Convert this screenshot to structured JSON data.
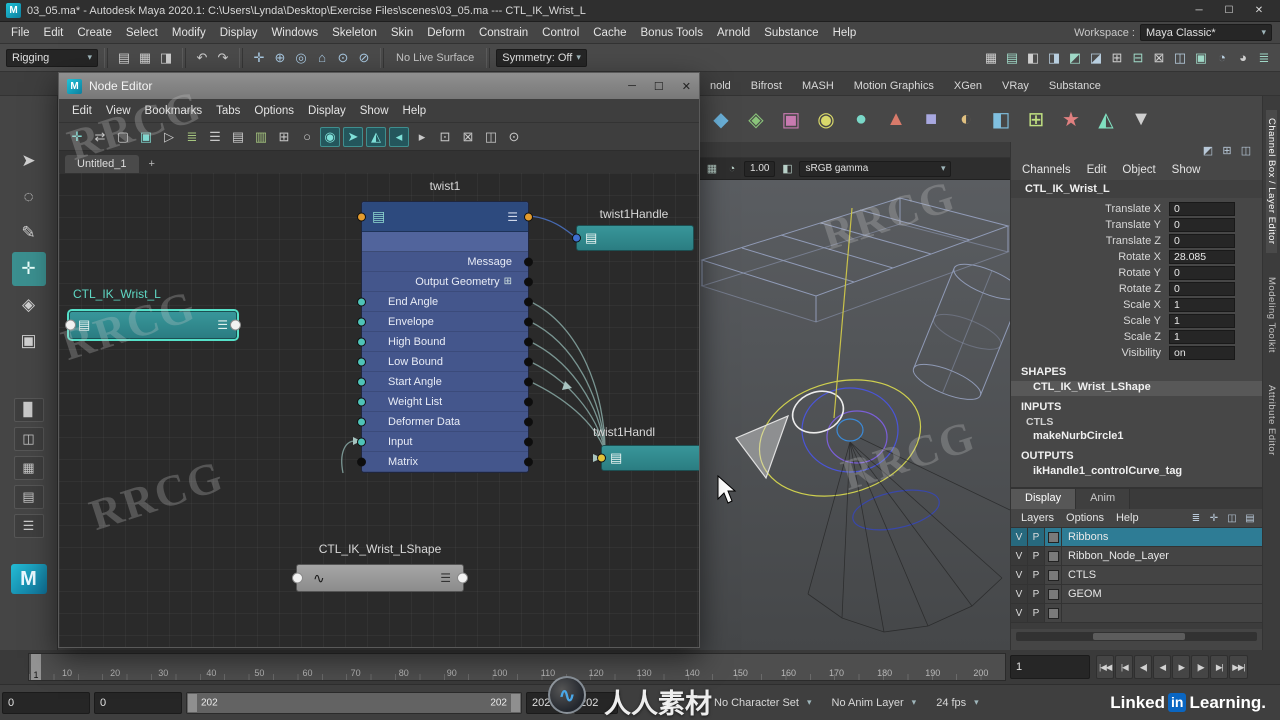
{
  "ui": {
    "caret": "▾"
  },
  "branding": {
    "badge": "M",
    "linkedin": "Linked",
    "in": "in",
    "learning": "Learning."
  },
  "window": {
    "title": "03_05.ma* - Autodesk Maya 2020.1: C:\\Users\\Lynda\\Desktop\\Exercise Files\\scenes\\03_05.ma --- CTL_IK_Wrist_L",
    "minimize": "─",
    "maximize": "☐",
    "close": "✕"
  },
  "menu_bar": {
    "items": [
      "File",
      "Edit",
      "Create",
      "Select",
      "Modify",
      "Display",
      "Windows",
      "Skeleton",
      "Skin",
      "Deform",
      "Constrain",
      "Control",
      "Cache",
      "Bonus Tools",
      "Arnold",
      "Substance",
      "Help"
    ],
    "workspace_label": "Workspace :",
    "workspace_value": "Maya Classic*"
  },
  "status_line": {
    "mode": "Rigging",
    "file_icons": [
      "▤",
      "▦",
      "◨"
    ],
    "snap_icons": [
      "✛",
      "⊕",
      "◎",
      "⌂",
      "⊙",
      "⊘"
    ],
    "hist_icons": [
      "↶",
      "↷"
    ],
    "live_surface": "No Live Surface",
    "symmetry": "Symmetry: Off",
    "right_icons": [
      "▦",
      "▤",
      "◧",
      "◨",
      "◩",
      "◪",
      "⊞",
      "⊟",
      "⊠",
      "◫",
      "▣",
      "◔",
      "◕",
      "≣"
    ]
  },
  "shelf": {
    "tabs": [
      "nold",
      "Bifrost",
      "MASH",
      "Motion Graphics",
      "XGen",
      "VRay",
      "Substance"
    ],
    "icons": [
      "◆",
      "◈",
      "▣",
      "◉",
      "●",
      "▲",
      "■",
      "◐",
      "◧",
      "⊞",
      "★",
      "◭",
      "▼"
    ]
  },
  "toolbox": {
    "tools": [
      "➤",
      "◌",
      "✎",
      "✛",
      "◈",
      "▣"
    ],
    "layouts": [
      "▉",
      "◫",
      "▦",
      "▤",
      "☰"
    ],
    "logo": "M"
  },
  "node_editor": {
    "title": "Node Editor",
    "menus": [
      "Edit",
      "View",
      "Bookmarks",
      "Tabs",
      "Options",
      "Display",
      "Show",
      "Help"
    ],
    "toolbar_icons": [
      "✛",
      "⇄",
      "▢",
      "▣",
      "▷",
      "≣",
      "☰",
      "▤",
      "▥",
      "⊞",
      "○",
      "◉",
      "➤",
      "◭",
      "◂",
      "▸",
      "⊡",
      "⊠",
      "◫",
      "⊙"
    ],
    "tab": "Untitled_1",
    "tab_add": "+",
    "glyphs": {
      "stack": "▤",
      "menu": "☰",
      "file": "▤",
      "curve": "∿",
      "expand": "⊞"
    },
    "twist1": {
      "title": "twist1",
      "rows": [
        "Message",
        "Output Geometry",
        "End Angle",
        "Envelope",
        "High Bound",
        "Low Bound",
        "Start Angle",
        "Weight List",
        "Deformer Data",
        "Input",
        "Matrix"
      ]
    },
    "handle1": {
      "title": "twist1Handle"
    },
    "wrist": {
      "title": "CTL_IK_Wrist_L"
    },
    "handle2": {
      "title": "twist1Handl"
    },
    "shape": {
      "title": "CTL_IK_Wrist_LShape"
    }
  },
  "viewport": {
    "exposure": "1.00",
    "gamma": "sRGB gamma",
    "icons": [
      "▦",
      "◔",
      "◧"
    ]
  },
  "channel_box": {
    "mini_icons": [
      "◩",
      "⊞",
      "◫"
    ],
    "menus": [
      "Channels",
      "Edit",
      "Object",
      "Show"
    ],
    "object_name": "CTL_IK_Wrist_L",
    "attributes": [
      {
        "label": "Translate X",
        "value": "0"
      },
      {
        "label": "Translate Y",
        "value": "0"
      },
      {
        "label": "Translate Z",
        "value": "0"
      },
      {
        "label": "Rotate X",
        "value": "28.085"
      },
      {
        "label": "Rotate Y",
        "value": "0"
      },
      {
        "label": "Rotate Z",
        "value": "0"
      },
      {
        "label": "Scale X",
        "value": "1"
      },
      {
        "label": "Scale Y",
        "value": "1"
      },
      {
        "label": "Scale Z",
        "value": "1"
      },
      {
        "label": "Visibility",
        "value": "on"
      }
    ],
    "shapes_header": "SHAPES",
    "shape_name": "CTL_IK_Wrist_LShape",
    "inputs_header": "INPUTS",
    "inputs": [
      "CTLS",
      "makeNurbCircle1"
    ],
    "outputs_header": "OUTPUTS",
    "outputs": [
      "ikHandle1_controlCurve_tag"
    ]
  },
  "layer_editor": {
    "tabs": [
      "Display",
      "Anim"
    ],
    "menus": [
      "Layers",
      "Options",
      "Help"
    ],
    "icons": [
      "≣",
      "✛",
      "◫",
      "▤"
    ],
    "layers": [
      {
        "v": "V",
        "p": "P",
        "name": "Ribbons",
        "selected": true
      },
      {
        "v": "V",
        "p": "P",
        "name": "Ribbon_Node_Layer",
        "selected": false
      },
      {
        "v": "V",
        "p": "P",
        "name": "CTLS",
        "selected": false
      },
      {
        "v": "V",
        "p": "P",
        "name": "GEOM",
        "selected": false
      },
      {
        "v": "V",
        "p": "P",
        "name": "",
        "selected": false
      }
    ]
  },
  "right_strip": {
    "tabs": [
      "Channel Box / Layer Editor",
      "Modeling Toolkit",
      "Attribute Editor"
    ]
  },
  "timeline": {
    "start_label": "1",
    "current_frame": "1",
    "ticks": [
      "10",
      "20",
      "30",
      "40",
      "50",
      "60",
      "70",
      "80",
      "90",
      "100",
      "110",
      "120",
      "130",
      "140",
      "150",
      "160",
      "170",
      "180",
      "190",
      "200"
    ],
    "playback": [
      "|◀◀",
      "|◀",
      "◀|",
      "◀",
      "▶",
      "|▶",
      "▶|",
      "▶▶|"
    ]
  },
  "range_bar": {
    "anim_start": "0",
    "play_start": "0",
    "range_left": "202",
    "range_right": "202",
    "play_end": "202",
    "anim_end": "202",
    "icons": [
      "◭",
      "◔"
    ],
    "character_set": "No Character Set",
    "anim_layer": "No Anim Layer",
    "fps": "24 fps"
  },
  "watermarks": {
    "brand": "RRCG",
    "cn": "人人素材",
    "logo_glyph": "∿"
  }
}
